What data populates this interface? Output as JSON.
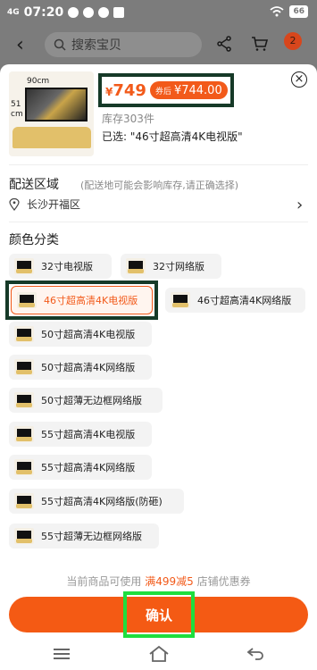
{
  "status_bar": {
    "signal": "4G",
    "time": "07:20",
    "battery": "66"
  },
  "nav": {
    "search_placeholder": "搜索宝贝",
    "cart_badge": "2"
  },
  "product": {
    "image_width_label": "90cm",
    "image_height_label": "51 cm",
    "price_symbol": "¥",
    "price": "749",
    "coupon_tag": "券后",
    "coupon_price": "¥744.00",
    "stock": "库存303件",
    "selected": "已选: \"46寸超高清4K电视版\"",
    "close": "×"
  },
  "region": {
    "title": "配送区域",
    "subtitle": "(配送地可能会影响库存,请正确选择)",
    "location": "长沙开福区"
  },
  "color_section": {
    "title": "颜色分类",
    "options": [
      {
        "label": "32寸电视版"
      },
      {
        "label": "32寸网络版"
      },
      {
        "label": "46寸超高清4K电视版",
        "selected": true
      },
      {
        "label": "46寸超高清4K网络版"
      },
      {
        "label": "50寸超高清4K电视版"
      },
      {
        "label": "50寸超高清4K网络版"
      },
      {
        "label": "50寸超薄无边框网络版"
      },
      {
        "label": "55寸超高清4K电视版"
      },
      {
        "label": "55寸超高清4K网络版"
      },
      {
        "label": "55寸超高清4K网络版(防砸)"
      },
      {
        "label": "55寸超薄无边框网络版"
      }
    ]
  },
  "promo": {
    "prefix": "当前商品可使用",
    "highlight": "满499减5",
    "suffix": "店铺优惠券"
  },
  "confirm_label": "确认",
  "colors": {
    "accent": "#f25a1a",
    "highlight_frame": "#163a28",
    "confirm_frame": "#1ede3e"
  }
}
